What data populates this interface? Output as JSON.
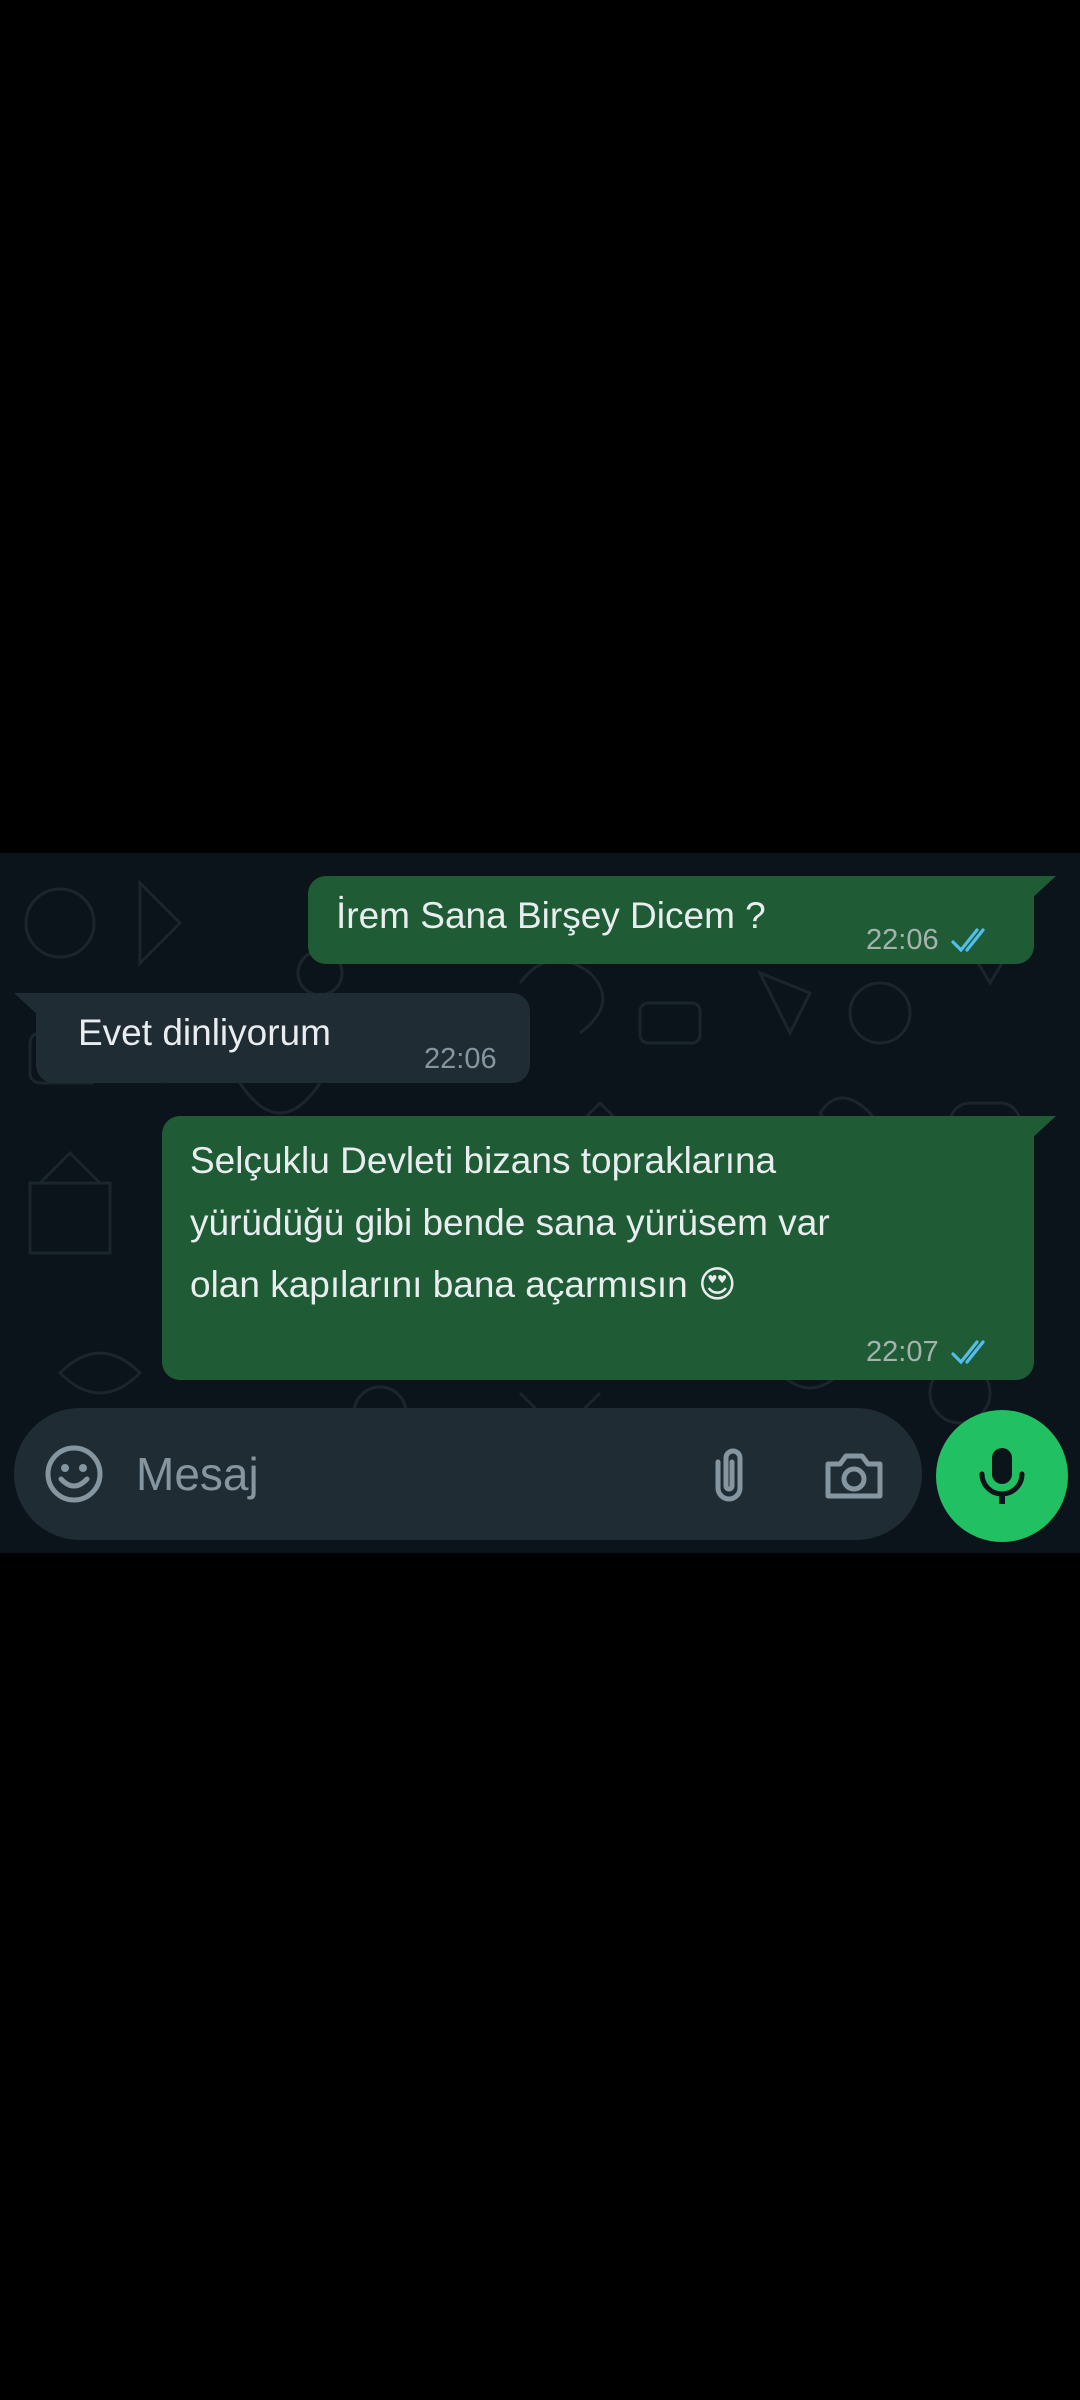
{
  "messages": [
    {
      "direction": "outgoing",
      "text": "İrem Sana Birşey Dicem ?",
      "time": "22:06",
      "status": "read"
    },
    {
      "direction": "incoming",
      "text": "Evet dinliyorum",
      "time": "22:06"
    },
    {
      "direction": "outgoing",
      "text": "Selçuklu Devleti bizans topraklarına\nyürüdüğü gibi bende sana yürüsem var\nolan kapılarını bana açarmısın 😍",
      "time": "22:07",
      "status": "read"
    }
  ],
  "composer": {
    "placeholder": "Mesaj",
    "icons": [
      "emoji-icon",
      "paperclip-icon",
      "camera-icon",
      "microphone-icon"
    ]
  },
  "colors": {
    "background": "#0b141a",
    "outgoing_bubble": "#1f5c36",
    "incoming_bubble": "#202c33",
    "read_ticks": "#53bdeb",
    "mic_button": "#21c063"
  }
}
